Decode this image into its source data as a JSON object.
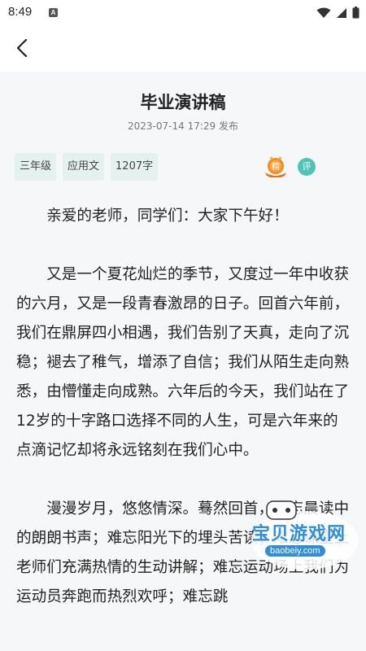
{
  "status_bar": {
    "time": "8:49",
    "notification_icon_letter": "A",
    "icons": [
      "wifi-icon",
      "signal-icon",
      "battery-icon"
    ]
  },
  "header": {
    "back_icon": "chevron-left-icon"
  },
  "article": {
    "title": "毕业演讲稿",
    "meta": "2023-07-14 17:29 发布",
    "tags": [
      "三年级",
      "应用文",
      "1207字"
    ],
    "badge_jing": "精",
    "badge_ping": "评",
    "paragraphs": [
      "亲爱的老师，同学们：大家下午好！",
      "又是一个夏花灿烂的季节，又度过一年中收获的六月，又是一段青春激昂的日子。回首六年前，我们在鼎屏四小相遇，我们告别了天真，走向了沉稳；褪去了稚气，增添了自信；我们从陌生走向熟悉，由懵懂走向成熟。六年后的今天，我们站在了12岁的十字路口选择不同的人生，可是六年来的点滴记忆却将永远铭刻在我们心中。",
      "漫漫岁月，悠悠情深。蓦然回首，难忘晨读中的朗朗书声；难忘阳光下的埋头苦读；难忘课堂上老师们充满热情的生动讲解；难忘运动场上我们为运动员奔跑而热烈欢呼；难忘跳"
    ]
  },
  "watermark": {
    "text": "宝贝游戏网",
    "url": "baobeiy.com"
  },
  "colors": {
    "tag_bg": "#e4f1ee",
    "content_bg": "#f6f7f8",
    "ping_badge": "#4fc3b4",
    "jing_badge": "#f08a24"
  }
}
